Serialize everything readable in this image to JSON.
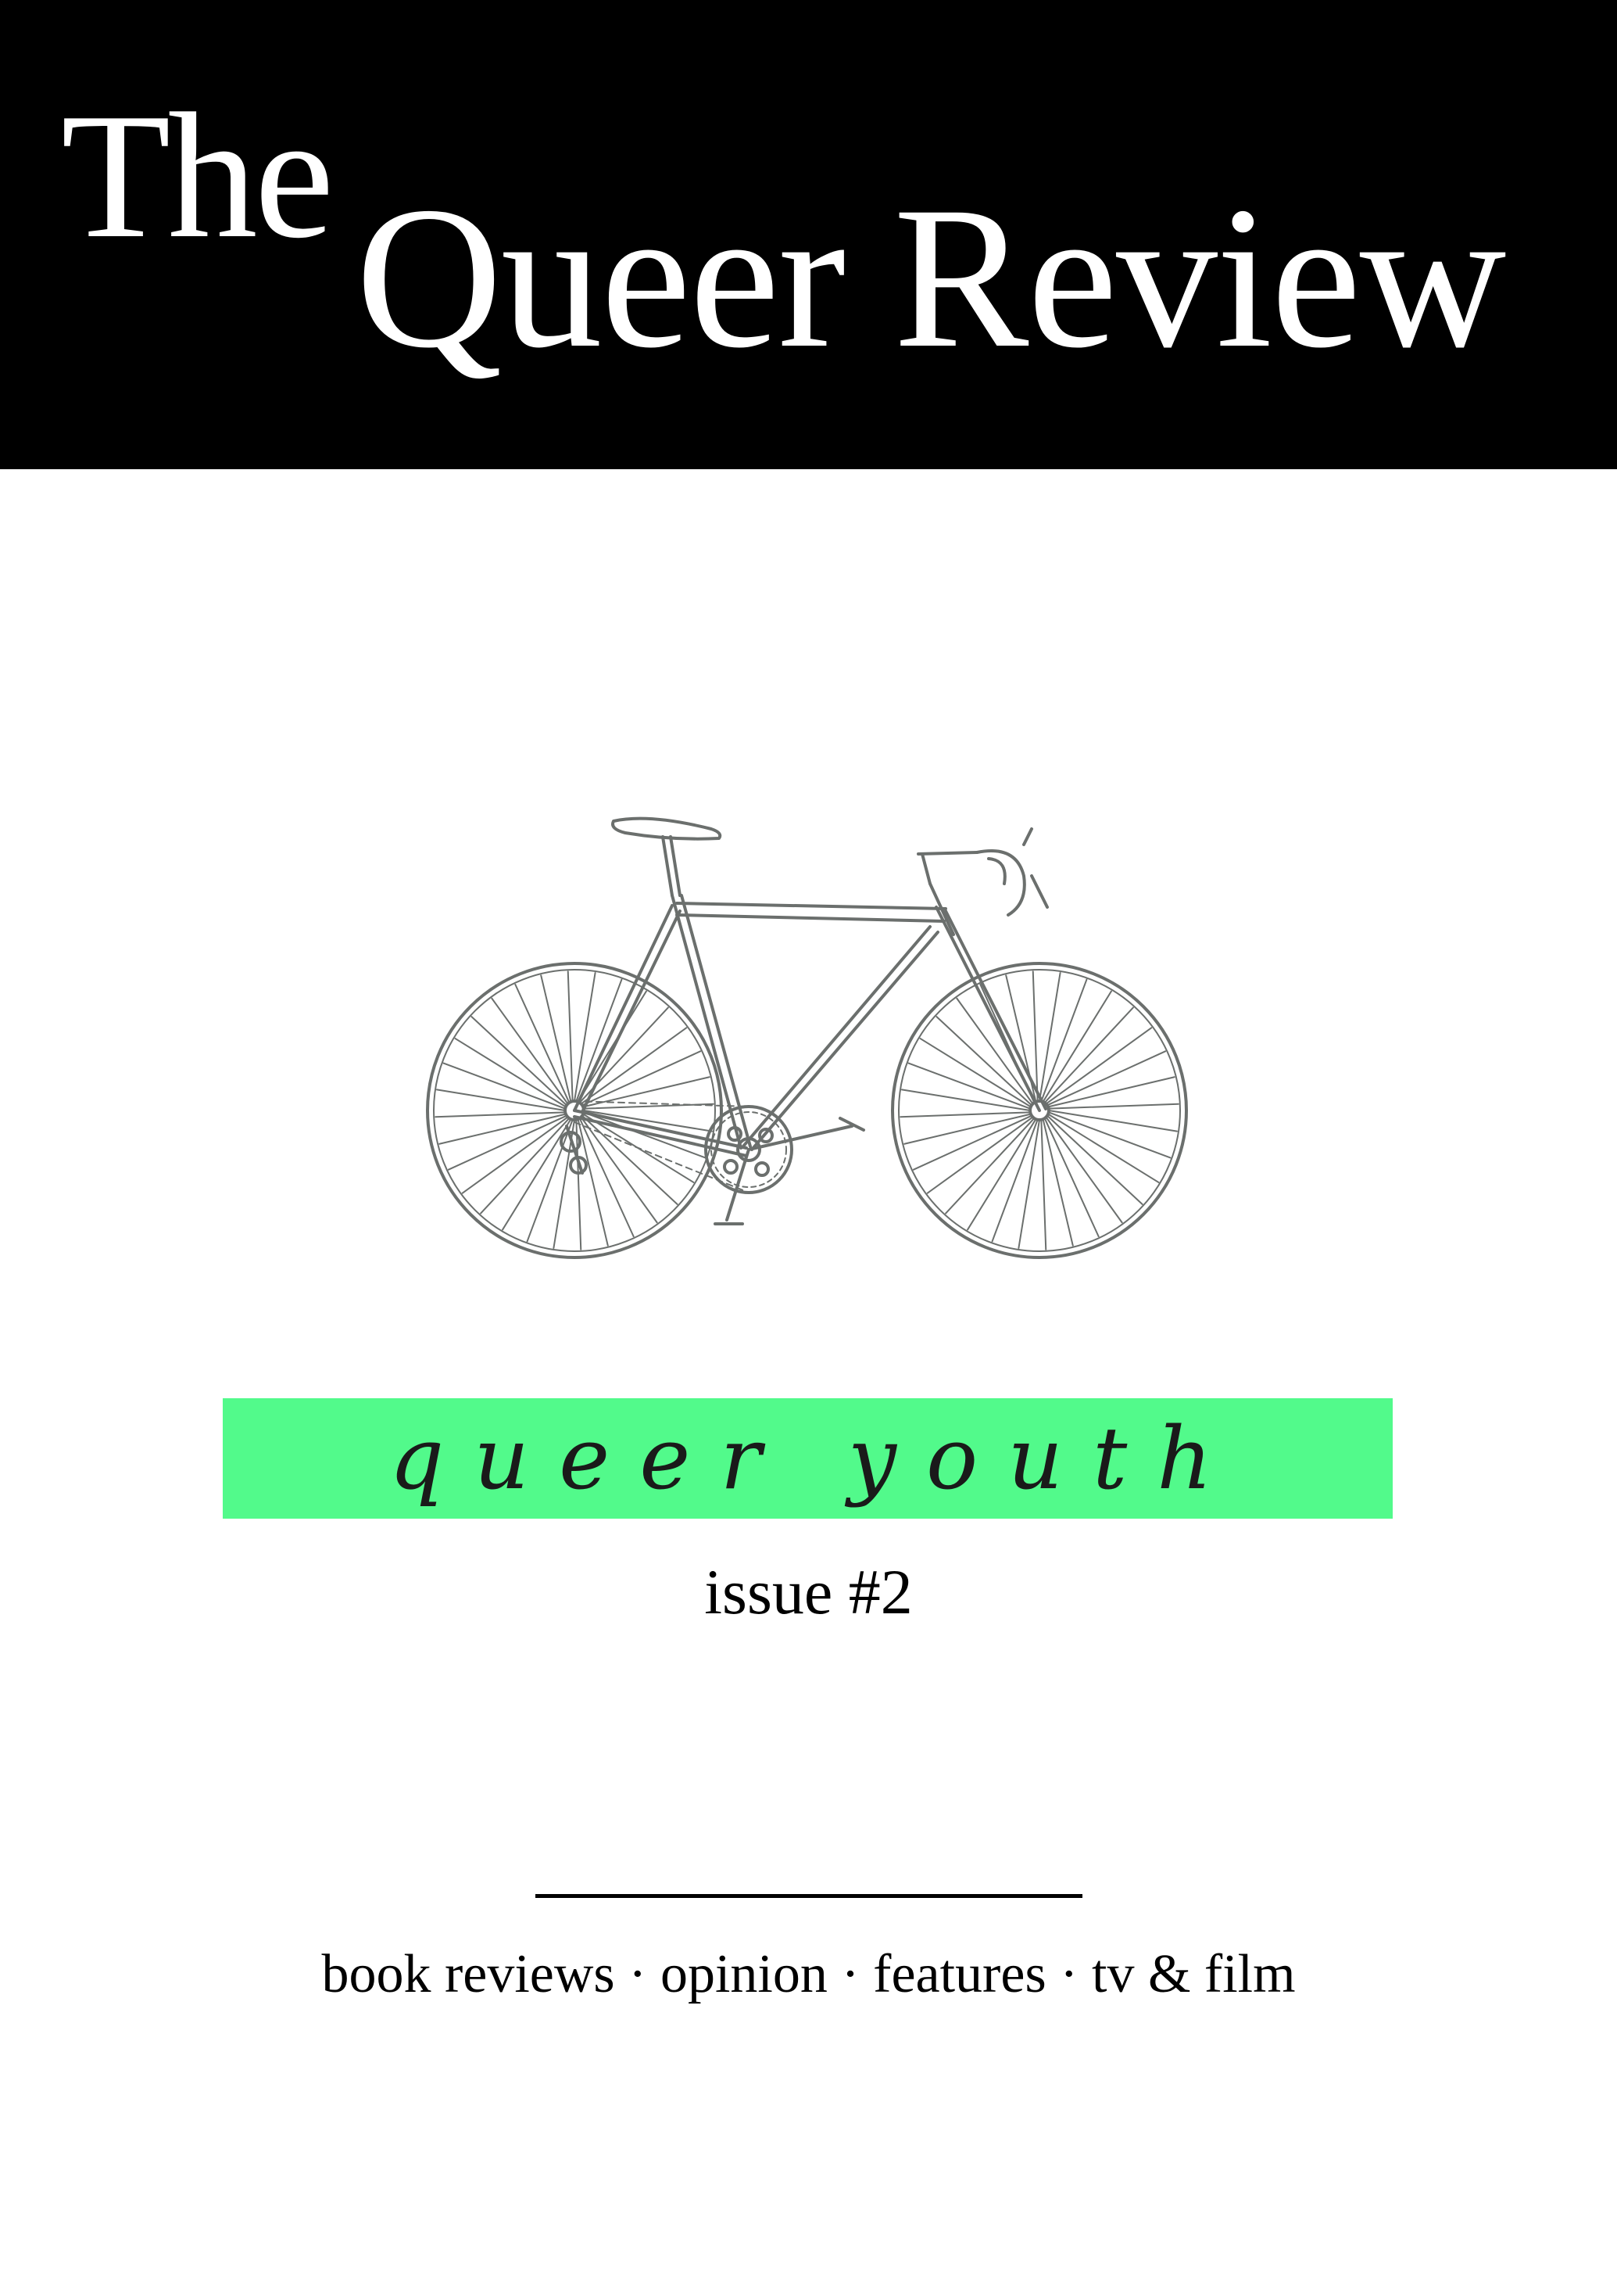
{
  "masthead": {
    "the": "The",
    "title": "Queer Review"
  },
  "cover": {
    "illustration_icon": "road-bicycle-icon",
    "theme": "queer youth",
    "issue": "issue #2",
    "sections": "book reviews · opinion · features · tv & film"
  },
  "colors": {
    "masthead_bg": "#000000",
    "masthead_text": "#ffffff",
    "banner": "#52fa8b",
    "illustration_line": "#6b6f6d"
  }
}
